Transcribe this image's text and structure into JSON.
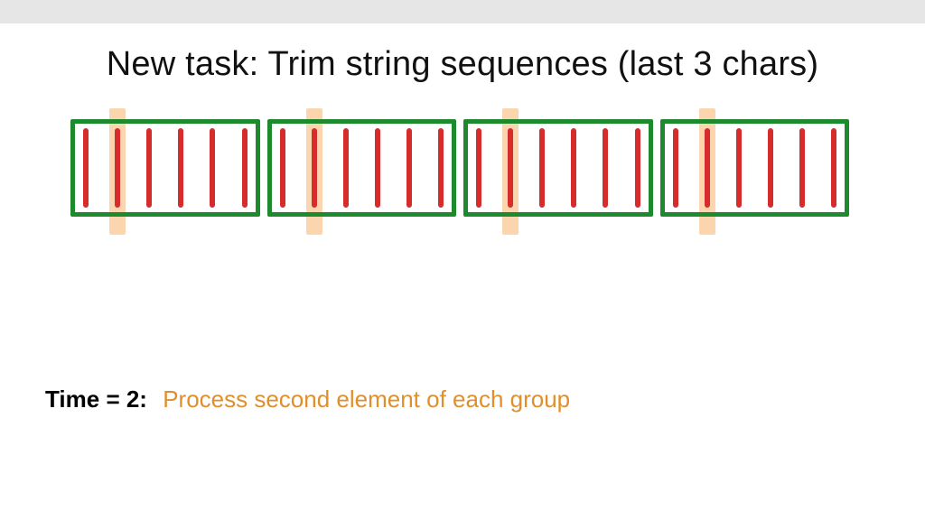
{
  "title": "New task: Trim string sequences (last 3 chars)",
  "caption": {
    "label": "Time = 2:",
    "description": "Process second element of each group"
  },
  "diagram": {
    "groups": 4,
    "elements_per_group": 6,
    "highlighted_element_index": 1,
    "colors": {
      "group_border": "#1e8a2e",
      "element_bar": "#d62c2c",
      "highlight": "#f6b26b"
    }
  }
}
